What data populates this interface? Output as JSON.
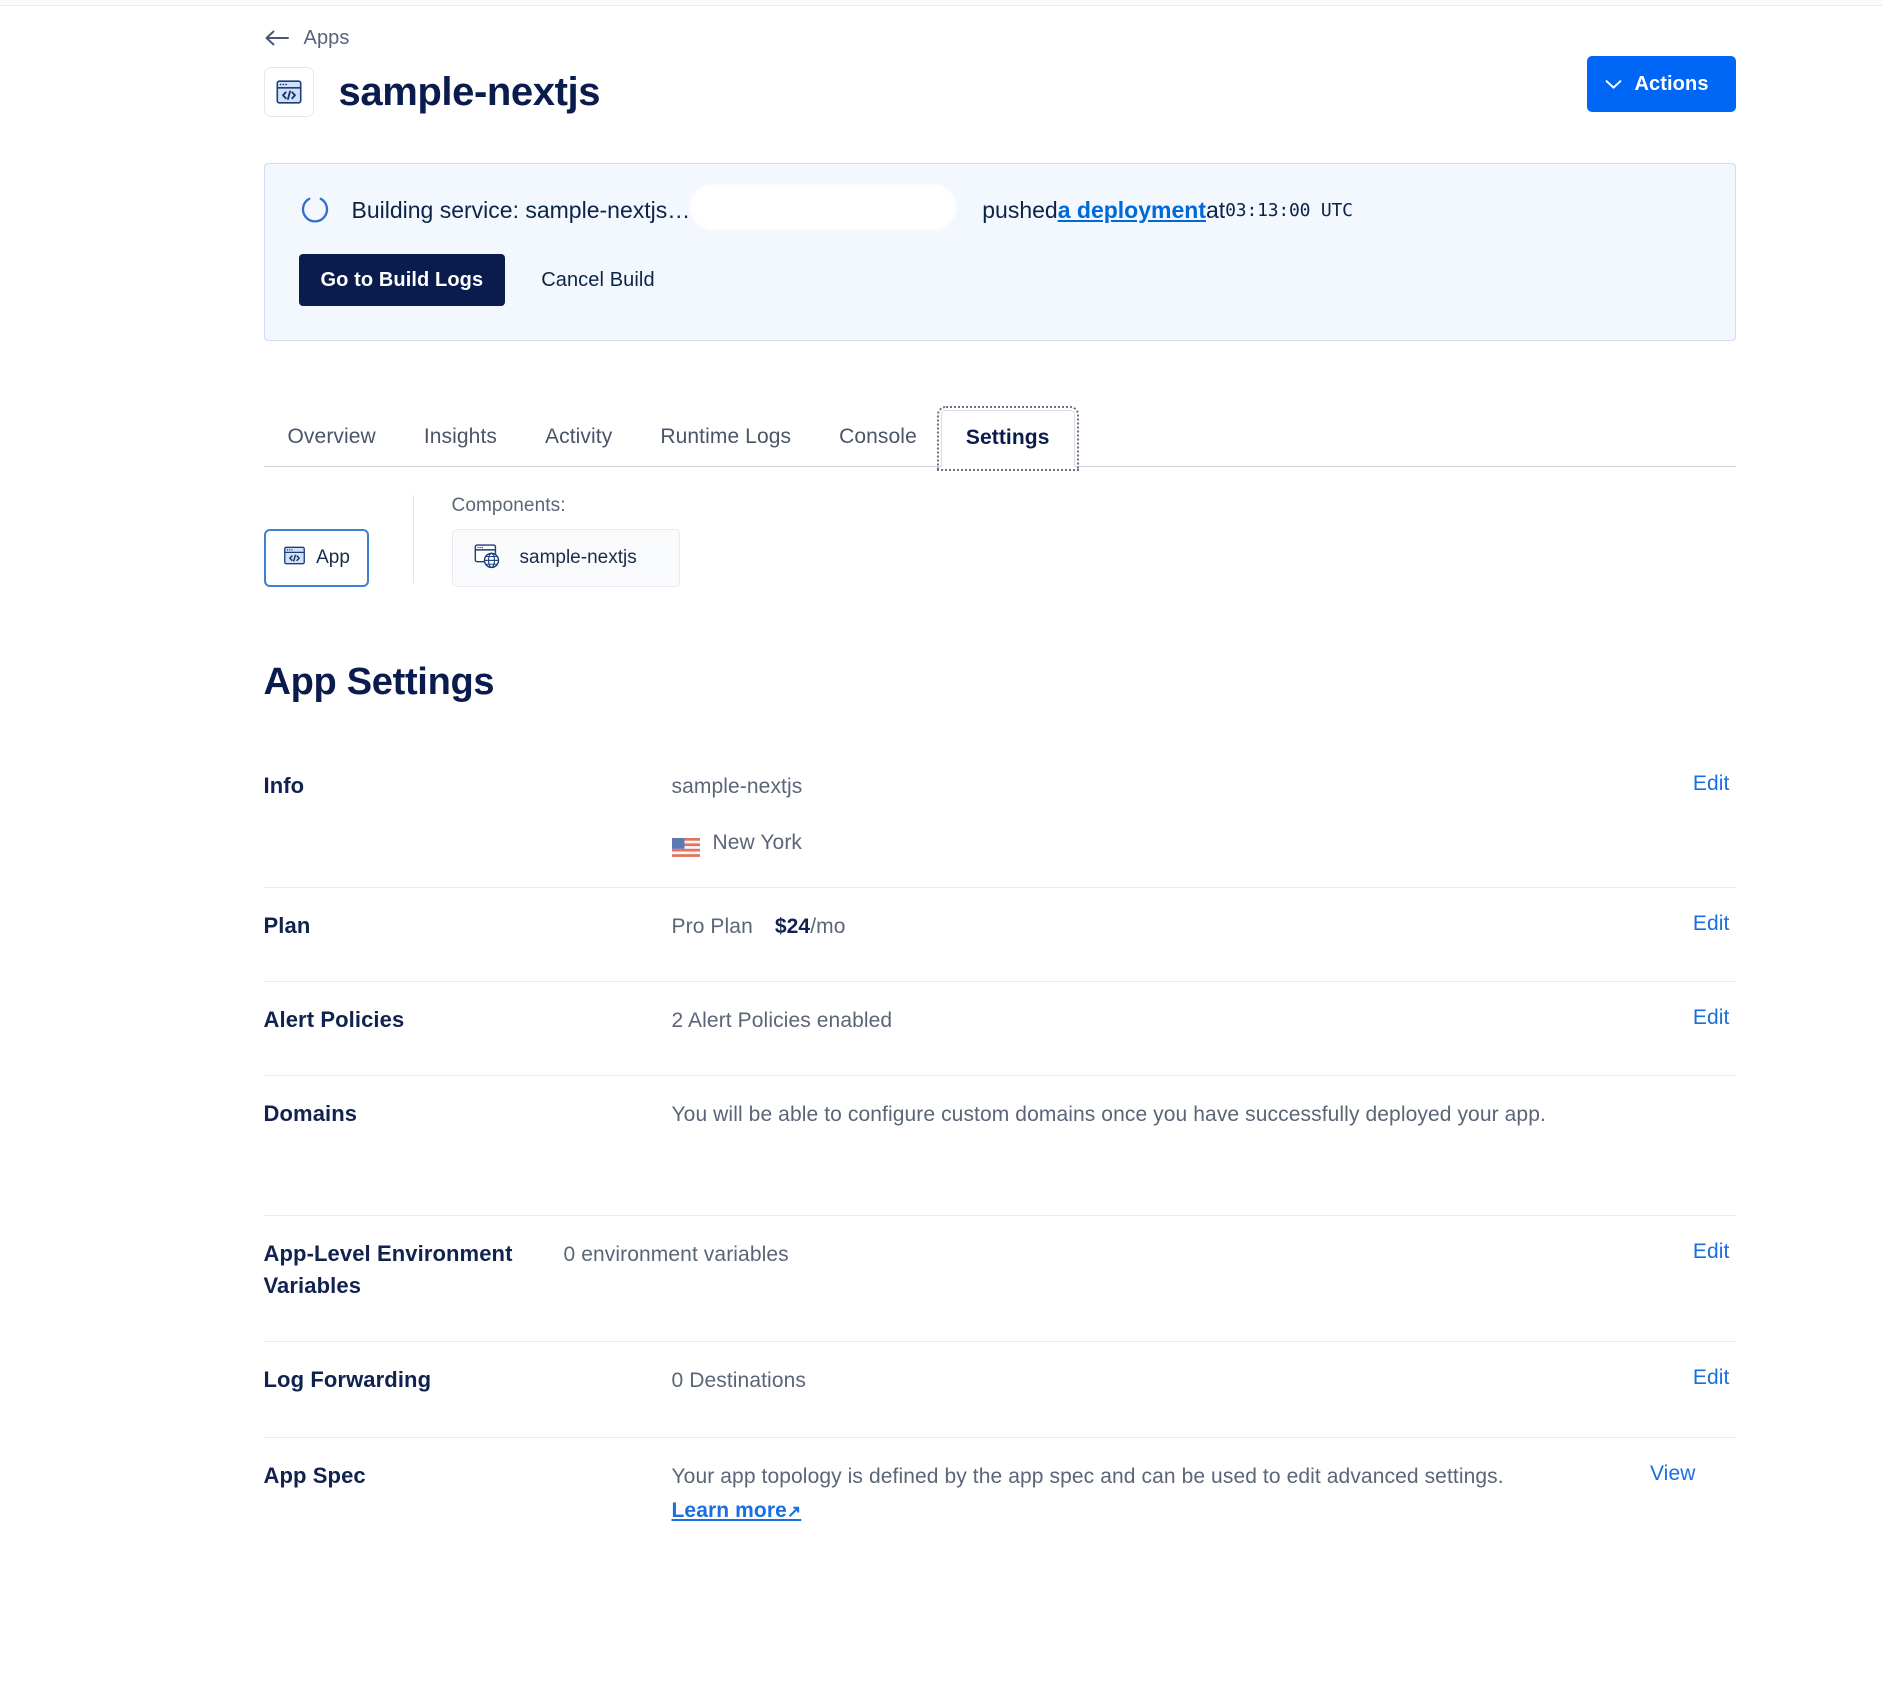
{
  "breadcrumb": {
    "label": "Apps",
    "icon": "arrow-left-icon"
  },
  "header": {
    "title": "sample-nextjs",
    "app_icon": "code-window-icon",
    "actions_button": {
      "label": "Actions",
      "icon": "chevron-down-icon",
      "color": "#0066f5"
    }
  },
  "banner": {
    "icon": "loading-spinner-icon",
    "status": "Building service: sample-nextjs…",
    "redacted": "",
    "tail_before_link": "pushed ",
    "link": "a deployment",
    "tail_after_link": " at ",
    "time": "03:13:00 UTC",
    "primary_button": "Go to Build Logs",
    "secondary_button": "Cancel Build",
    "background": "#f3f7fe",
    "border": "#cddcf3"
  },
  "tabs": [
    {
      "label": "Overview",
      "active": false
    },
    {
      "label": "Insights",
      "active": false
    },
    {
      "label": "Activity",
      "active": false
    },
    {
      "label": "Runtime Logs",
      "active": false
    },
    {
      "label": "Console",
      "active": false
    },
    {
      "label": "Settings",
      "active": true
    }
  ],
  "scope_selector": {
    "app_card": {
      "label": "App",
      "icon": "code-window-icon",
      "selected": true
    },
    "components_label": "Components:",
    "components": [
      {
        "label": "sample-nextjs",
        "icon": "window-globe-icon"
      }
    ]
  },
  "settings": {
    "heading": "App Settings",
    "rows": [
      {
        "label": "Info",
        "value": "sample-nextjs",
        "region": "New York",
        "region_flag": "us-flag-icon",
        "action": "Edit"
      },
      {
        "label": "Plan",
        "plan_name": "Pro Plan",
        "price": "$24",
        "period": "/mo",
        "action": "Edit"
      },
      {
        "label": "Alert Policies",
        "value": "2 Alert Policies enabled",
        "action": "Edit"
      },
      {
        "label": "Domains",
        "value": "You will be able to configure custom domains once you have successfully deployed your app.",
        "action": ""
      },
      {
        "label": "App-Level Environment Variables",
        "value": "0 environment variables",
        "action": "Edit"
      },
      {
        "label": "Log Forwarding",
        "value": "0 Destinations",
        "action": "Edit"
      },
      {
        "label": "App Spec",
        "value": "Your app topology is defined by the app spec and can be used to edit advanced settings. ",
        "link": "Learn more",
        "link_icon": "external-link-icon",
        "action": "View"
      }
    ]
  },
  "colors": {
    "accent_blue": "#0066f5",
    "link_blue": "#1a6fe0",
    "navy": "#0a1b4d",
    "muted": "#5b6578"
  }
}
